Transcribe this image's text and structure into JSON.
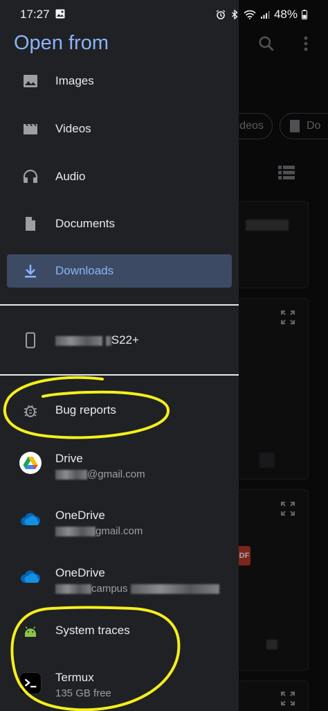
{
  "status_bar": {
    "time": "17:27",
    "battery": "48%"
  },
  "drawer": {
    "title": "Open from",
    "roots": [
      {
        "label": "Images",
        "icon": "image-icon"
      },
      {
        "label": "Videos",
        "icon": "movie-icon"
      },
      {
        "label": "Audio",
        "icon": "headphones-icon"
      },
      {
        "label": "Documents",
        "icon": "document-icon"
      },
      {
        "label": "Downloads",
        "icon": "download-icon",
        "selected": true
      }
    ],
    "device": {
      "label_suffix": "S22+",
      "icon": "phone-icon"
    },
    "providers": [
      {
        "label": "Bug reports",
        "icon": "bug-icon"
      },
      {
        "label": "Drive",
        "subtitle_suffix": "@gmail.com",
        "icon": "google-drive-icon"
      },
      {
        "label": "OneDrive",
        "subtitle_suffix": "gmail.com",
        "icon": "onedrive-icon"
      },
      {
        "label": "OneDrive",
        "subtitle_suffix": "campus",
        "icon": "onedrive-icon"
      },
      {
        "label": "System traces",
        "icon": "android-icon"
      },
      {
        "label": "Termux",
        "subtitle": "135 GB free",
        "icon": "termux-icon"
      }
    ]
  },
  "background": {
    "chip_videos": "ideos",
    "chip_docs": "Do",
    "pdf_badge": "DF"
  },
  "colors": {
    "drawer_bg": "#202124",
    "accent": "#8ab4f8",
    "selected_bg": "#3c4b63",
    "annotation": "#f5ef1c"
  }
}
